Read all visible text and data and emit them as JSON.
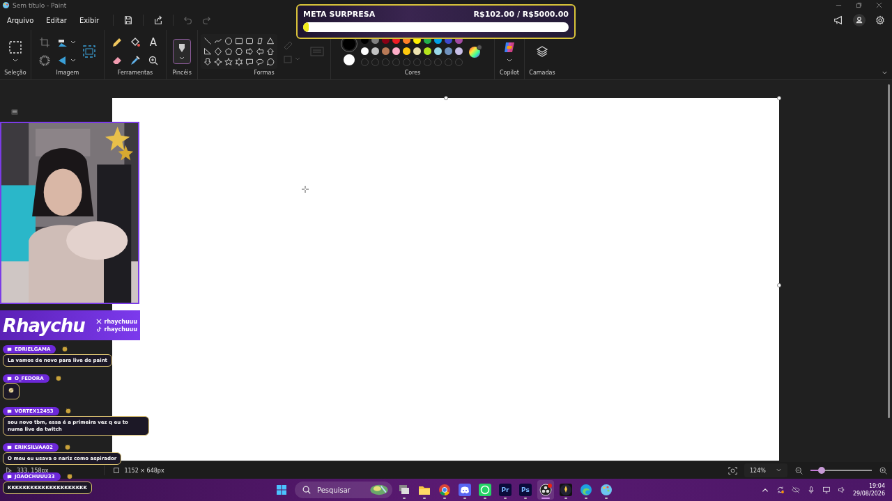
{
  "window": {
    "title": "Sem título - Paint"
  },
  "menu": [
    {
      "label": "Arquivo"
    },
    {
      "label": "Editar"
    },
    {
      "label": "Exibir"
    }
  ],
  "ribbon_groups": [
    {
      "kind": "selection",
      "label": "Seleção"
    },
    {
      "label": "Imagem"
    },
    {
      "kind": "tools",
      "label": "Ferramentas",
      "text_tool": "A"
    },
    {
      "kind": "brushes",
      "label": "Pincéis"
    },
    {
      "kind": "shapes",
      "label": "Formas"
    },
    {
      "kind": "colors",
      "label": "Cores",
      "active_colors": [
        {
          "color": "#000000"
        },
        {
          "color": "#ffffff"
        }
      ]
    },
    {
      "kind": "copilot",
      "label": "Copilot"
    },
    {
      "kind": "layers",
      "label": "Camadas"
    }
  ],
  "palette_rows": [
    {
      "swatches": [
        {
          "color": "#000000"
        },
        {
          "color": "#7f7f7f"
        },
        {
          "color": "#880015"
        },
        {
          "color": "#ed1c24"
        },
        {
          "color": "#ff7f27"
        },
        {
          "color": "#fff200"
        },
        {
          "color": "#22b14c"
        },
        {
          "color": "#00a2e8"
        },
        {
          "color": "#3f48cc"
        },
        {
          "color": "#a349a4"
        }
      ]
    },
    {
      "swatches": [
        {
          "color": "#ffffff"
        },
        {
          "color": "#c3c3c3"
        },
        {
          "color": "#b97a57"
        },
        {
          "color": "#ffaec9"
        },
        {
          "color": "#ffc90e"
        },
        {
          "color": "#efe4b0"
        },
        {
          "color": "#b5e61d"
        },
        {
          "color": "#99d9ea"
        },
        {
          "color": "#7092be"
        },
        {
          "color": "#c8bfe7"
        }
      ]
    }
  ],
  "goal": {
    "title": "META SURPRESA",
    "amount": "R$102.00 / R$5000.00",
    "level": 0.02
  },
  "stream_banner": {
    "name": "Rhaychu",
    "handles": [
      {
        "kind": "x",
        "text": "rhaychuuu"
      },
      {
        "kind": "tiktok",
        "text": "rhaychuuu"
      }
    ]
  },
  "chat": [
    {
      "user": "EDRIELGAMA",
      "kind": "text",
      "message": "La vamos de novo para live de paint"
    },
    {
      "user": "O_FEDORA",
      "kind": "emote"
    },
    {
      "user": "VORTEX12453",
      "kind": "text",
      "message": "sou novo tbm, essa é a primeira vez q eu to numa live da twitch"
    },
    {
      "user": "ERIKSILVAA02",
      "kind": "text",
      "message": "O meu eu usava o nariz como aspirador"
    },
    {
      "user": "JOAOCHUUU33",
      "kind": "text",
      "message": "KKKKKKKKKKKKKKKKKKKKK"
    }
  ],
  "status_bar": {
    "cursor": "333, 158px",
    "canvas_size": "1152 × 648px",
    "zoom": "124%",
    "zoom_slider": {
      "level": 0.18
    }
  },
  "taskbar": {
    "search": {
      "placeholder": "Pesquisar"
    },
    "apps": [
      {
        "kind": "taskview",
        "selected": false
      },
      {
        "kind": "folder",
        "selected": false
      },
      {
        "kind": "chrome",
        "selected": false
      },
      {
        "kind": "discord",
        "selected": false
      },
      {
        "kind": "whatsapp",
        "selected": false
      },
      {
        "kind": "lettered",
        "label": "Pr",
        "selected": false
      },
      {
        "kind": "lettered",
        "label": "Ps",
        "selected": false
      },
      {
        "kind": "obs",
        "selected": true
      },
      {
        "kind": "rocket",
        "selected": false
      },
      {
        "kind": "edge",
        "selected": false
      },
      {
        "kind": "palette",
        "selected": false
      }
    ],
    "time": "19:04",
    "date": "29/08/2026"
  }
}
